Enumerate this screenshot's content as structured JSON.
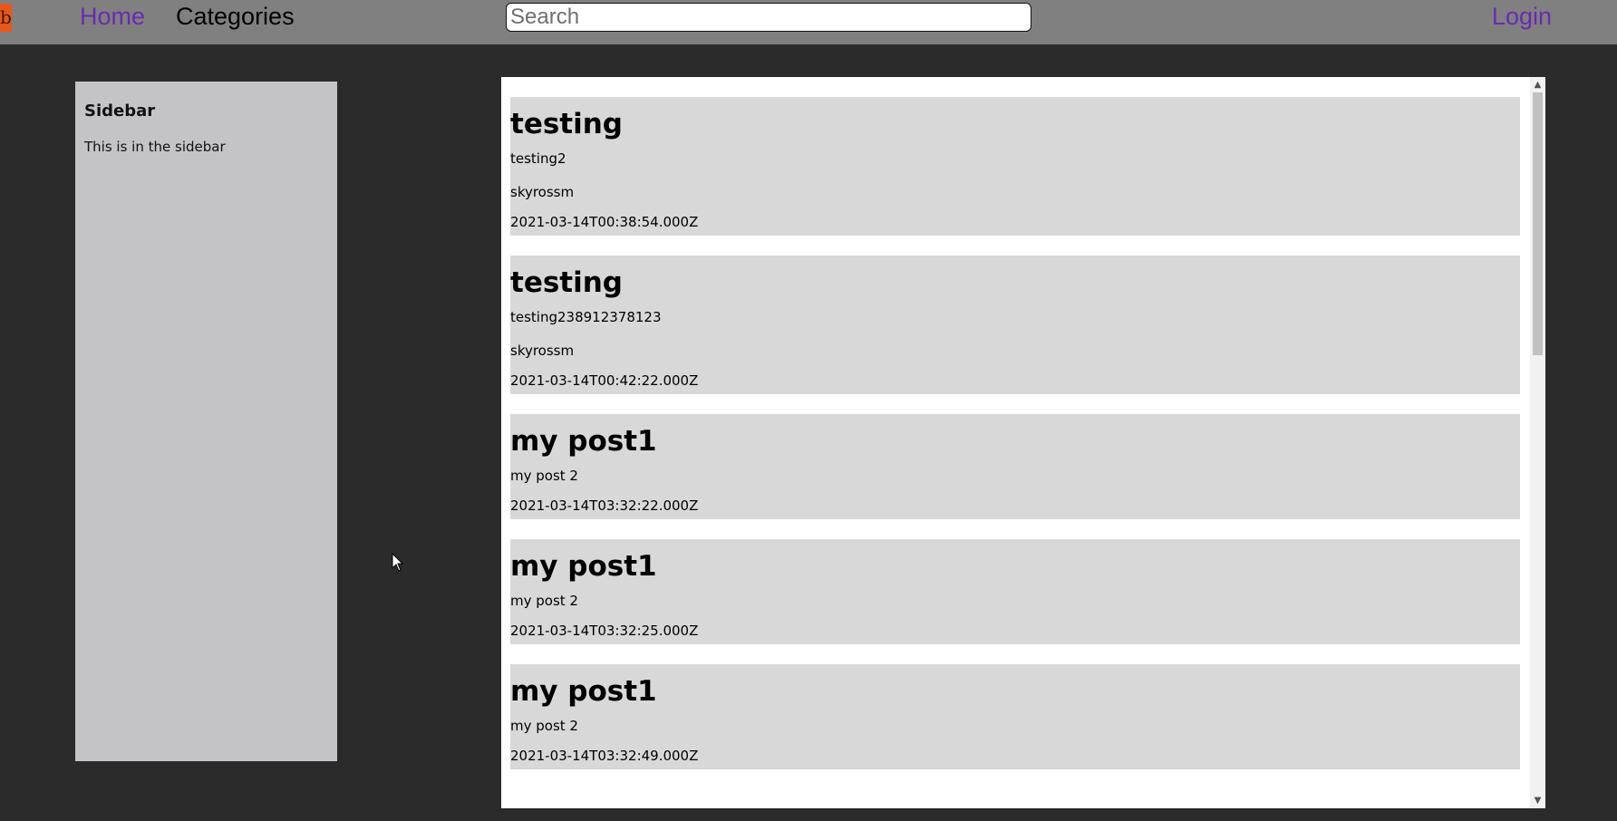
{
  "nav": {
    "logo_glyph": "b",
    "home_label": "Home",
    "categories_label": "Categories",
    "login_label": "Login",
    "search_placeholder": "Search",
    "search_value": ""
  },
  "sidebar": {
    "title": "Sidebar",
    "text": "This is in the sidebar"
  },
  "posts": [
    {
      "title": "testing",
      "body": "testing2",
      "author": "skyrossm",
      "date": "2021-03-14T00:38:54.000Z"
    },
    {
      "title": "testing",
      "body": "testing238912378123",
      "author": "skyrossm",
      "date": "2021-03-14T00:42:22.000Z"
    },
    {
      "title": "my post1",
      "body": "my post 2",
      "author": "",
      "date": "2021-03-14T03:32:22.000Z"
    },
    {
      "title": "my post1",
      "body": "my post 2",
      "author": "",
      "date": "2021-03-14T03:32:25.000Z"
    },
    {
      "title": "my post1",
      "body": "my post 2",
      "author": "",
      "date": "2021-03-14T03:32:49.000Z"
    }
  ],
  "colors": {
    "nav_bg": "#808080",
    "page_bg": "#2b2b2b",
    "link_purple": "#6a2bb0",
    "sidebar_bg": "#c4c4c6",
    "post_bg": "#d8d8d8",
    "logo_orange": "#e8581c"
  },
  "icons": {
    "scroll_up": "chevron-up-icon",
    "scroll_down": "chevron-down-icon",
    "cursor": "mouse-pointer-icon"
  }
}
